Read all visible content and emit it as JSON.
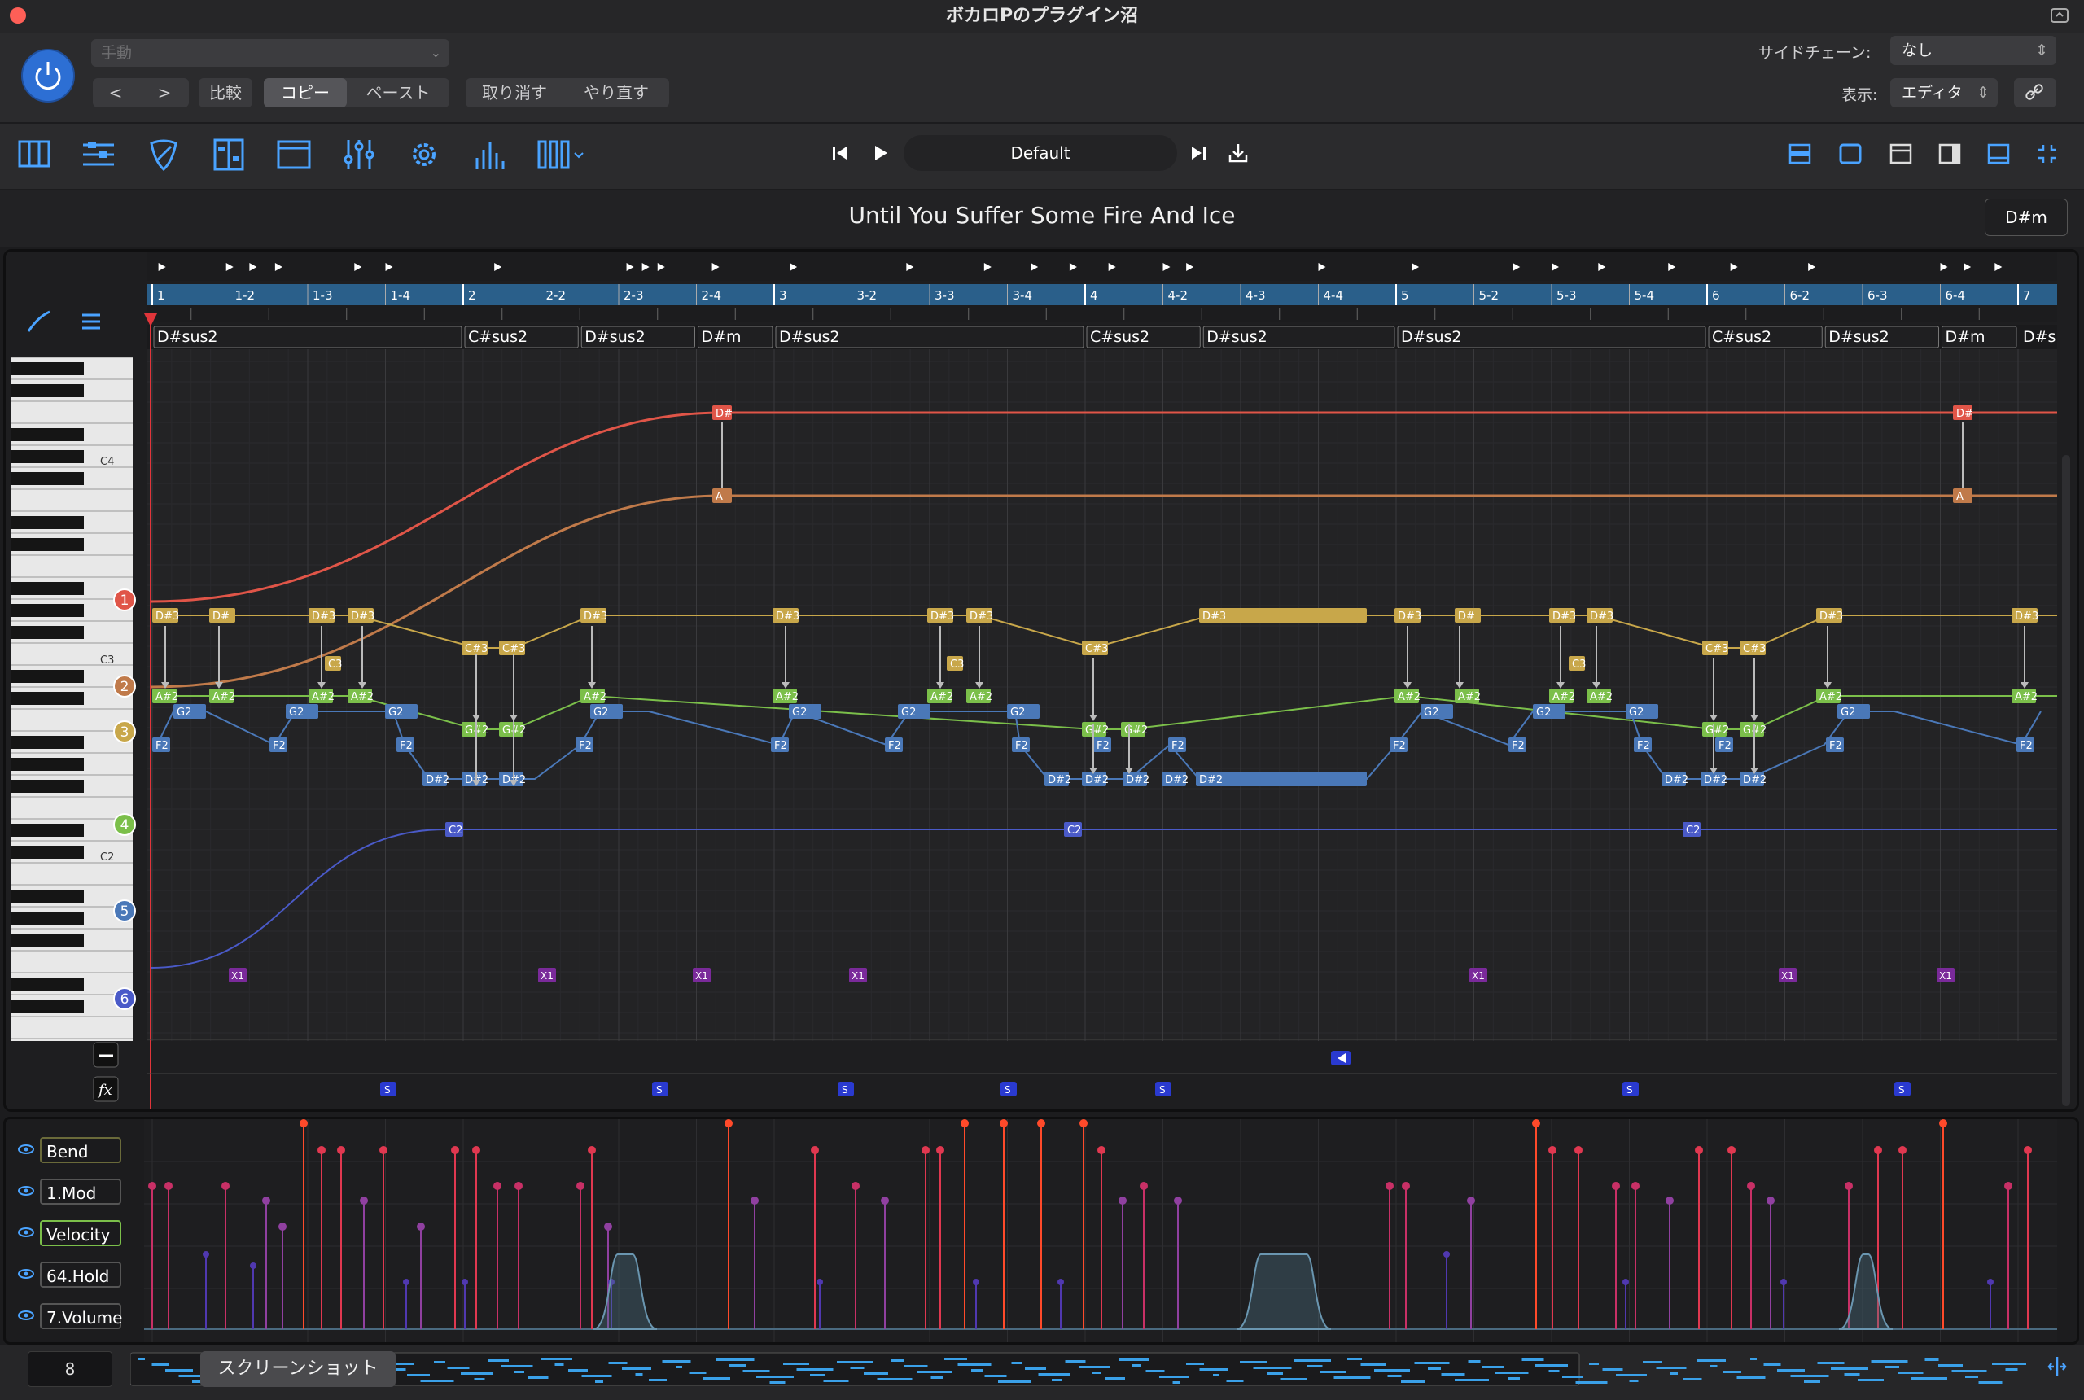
{
  "window": {
    "title": "ボカロPのプラグイン沼"
  },
  "header": {
    "preset_value": "手動",
    "compare_label": "比較",
    "copy_label": "コピー",
    "paste_label": "ペースト",
    "undo_label": "取り消す",
    "redo_label": "やり直す",
    "sidechain_label": "サイドチェーン:",
    "sidechain_value": "なし",
    "view_label": "表示:",
    "view_value": "エディタ"
  },
  "transport": {
    "snapshot_name": "Default"
  },
  "song": {
    "title": "Until You Suffer Some Fire And Ice",
    "key": "D#m"
  },
  "ruler": {
    "labels": [
      "1",
      "1-2",
      "1-3",
      "1-4",
      "2",
      "2-2",
      "2-3",
      "2-4",
      "3",
      "3-2",
      "3-3",
      "3-4",
      "4",
      "4-2",
      "4-3",
      "4-4",
      "5",
      "5-2",
      "5-3",
      "5-4",
      "6",
      "6-2",
      "6-3",
      "6-4",
      "7"
    ]
  },
  "chords": [
    "D#sus2",
    "C#sus2",
    "D#sus2",
    "D#m",
    "D#sus2",
    "C#sus2",
    "D#sus2",
    "D#sus2",
    "C#sus2",
    "D#sus2",
    "D#m",
    "D#s"
  ],
  "piano": {
    "labels": [
      "C4",
      "C3",
      "C2"
    ]
  },
  "voices": [
    "1",
    "2",
    "3",
    "4",
    "5",
    "6"
  ],
  "markers": {
    "x1": "X1",
    "s": "S"
  },
  "note_labels": {
    "v1": "D#",
    "v2": "A",
    "v3a": "D#3",
    "v3b": "C#3",
    "v3c": "C3",
    "v4a": "A#2",
    "v4b": "G#2",
    "v5a": "G2",
    "v5b": "F2",
    "v5c": "D#2",
    "v5d": "D#",
    "v6": "C2"
  },
  "lanes": [
    "Bend",
    "1.Mod",
    "Velocity",
    "64.Hold",
    "7.Volume"
  ],
  "bottom": {
    "zoom_value": "8",
    "tooltip": "スクリーンショット"
  },
  "colors": {
    "accent": "#2d6fd4",
    "ruler": "#2a5f8a",
    "voice1": "#e05548",
    "voice2": "#c07a4a",
    "voice3": "#c8a74a",
    "voice4": "#7bbf4a",
    "voice5": "#4a78b8",
    "voice6": "#4a5ac8"
  }
}
